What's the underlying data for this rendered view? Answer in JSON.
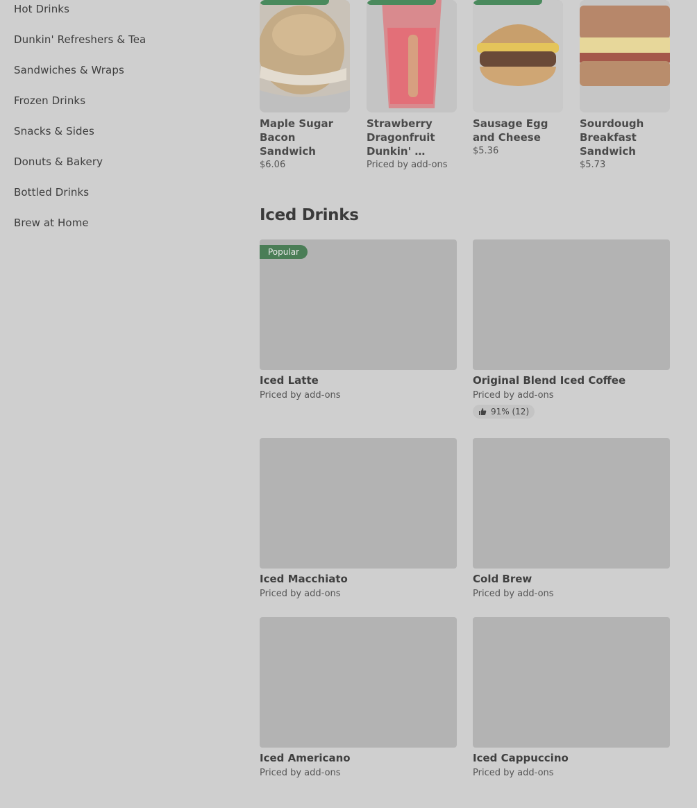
{
  "sidebar": {
    "items": [
      {
        "label": "Hot Drinks"
      },
      {
        "label": "Dunkin' Refreshers & Tea"
      },
      {
        "label": "Sandwiches & Wraps"
      },
      {
        "label": "Frozen Drinks"
      },
      {
        "label": "Snacks & Sides"
      },
      {
        "label": "Donuts & Bakery"
      },
      {
        "label": "Bottled Drinks"
      },
      {
        "label": "Brew at Home"
      }
    ]
  },
  "top_items": [
    {
      "name_l1": "Maple Sugar",
      "name_l2": "Bacon Sandwich",
      "name_l3": "",
      "price": "$6.06"
    },
    {
      "name_l1": "Strawberry",
      "name_l2": "Dragonfruit",
      "name_l3": "Dunkin' …",
      "price": "Priced by add-ons"
    },
    {
      "name_l1": "Sausage Egg",
      "name_l2": "and Cheese",
      "name_l3": "",
      "price": "$5.36"
    },
    {
      "name_l1": "Sourdough",
      "name_l2": "Breakfast",
      "name_l3": "Sandwich",
      "price": "$5.73"
    }
  ],
  "section": {
    "title": "Iced Drinks",
    "items": [
      {
        "name": "Iced Latte",
        "price": "Priced by add-ons",
        "badge": "Popular"
      },
      {
        "name": "Original Blend Iced Coffee",
        "price": "Priced by add-ons",
        "rating": "91% (12)"
      },
      {
        "name": "Iced Macchiato",
        "price": "Priced by add-ons"
      },
      {
        "name": "Cold Brew",
        "price": "Priced by add-ons"
      },
      {
        "name": "Iced Americano",
        "price": "Priced by add-ons"
      },
      {
        "name": "Iced Cappuccino",
        "price": "Priced by add-ons"
      }
    ]
  },
  "colors": {
    "overlay_bg": "#cfcfcf",
    "placeholder": "#b3b3b3",
    "badge_green": "#4a7d56"
  }
}
